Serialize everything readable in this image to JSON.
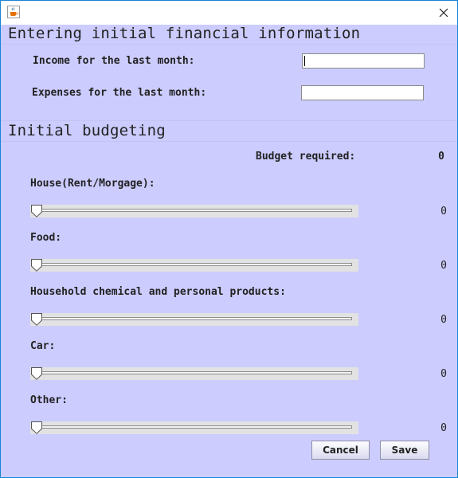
{
  "window": {
    "title": "",
    "close_icon": "close-icon",
    "app_icon": "java-coffee-cup-icon"
  },
  "financial_section": {
    "title": "Entering initial financial information",
    "income_label": "Income for the last month:",
    "income_value": "",
    "expenses_label": "Expenses for the last month:",
    "expenses_value": ""
  },
  "budget_section": {
    "title": "Initial budgeting",
    "budget_required_label": "Budget required:",
    "budget_required_value": "0",
    "categories": [
      {
        "label": "House(Rent/Morgage):",
        "slider_value": 0,
        "value": "0"
      },
      {
        "label": "Food:",
        "slider_value": 0,
        "value": "0"
      },
      {
        "label": "Household chemical and personal products:",
        "slider_value": 0,
        "value": "0"
      },
      {
        "label": "Car:",
        "slider_value": 0,
        "value": "0"
      },
      {
        "label": "Other:",
        "slider_value": 0,
        "value": "0"
      }
    ]
  },
  "buttons": {
    "cancel_label": "Cancel",
    "save_label": "Save"
  },
  "colors": {
    "panel_background": "#ccccff",
    "window_border": "#1883d7"
  }
}
